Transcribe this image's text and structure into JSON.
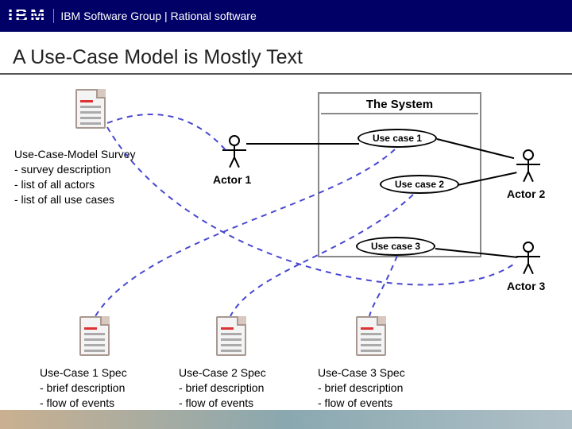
{
  "header": {
    "logo_text": "IBM",
    "breadcrumb": "IBM Software Group | Rational software"
  },
  "title": "A Use-Case Model is Mostly Text",
  "survey": {
    "heading": "Use-Case-Model Survey",
    "line1": "- survey description",
    "line2": "- list of all actors",
    "line3": "- list of all use cases"
  },
  "system": {
    "title": "The System",
    "uc1": "Use case 1",
    "uc2": "Use case 2",
    "uc3": "Use case 3"
  },
  "actors": {
    "a1": "Actor 1",
    "a2": "Actor 2",
    "a3": "Actor 3"
  },
  "specs": {
    "s1_title": "Use-Case 1 Spec",
    "s2_title": "Use-Case 2 Spec",
    "s3_title": "Use-Case 3 Spec",
    "bullet1": "- brief description",
    "bullet2": "- flow of events"
  }
}
